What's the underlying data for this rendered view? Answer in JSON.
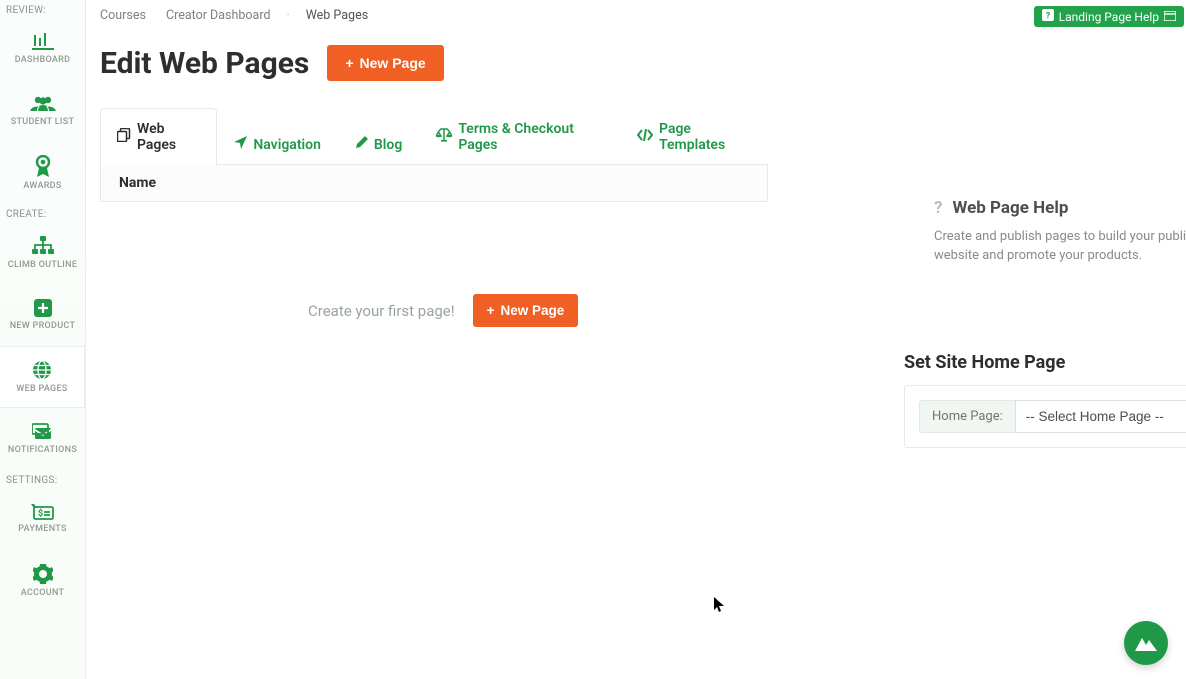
{
  "sidebar": {
    "sections": {
      "review": {
        "label": "REVIEW:"
      },
      "create": {
        "label": "CREATE:"
      },
      "settings": {
        "label": "SETTINGS:"
      }
    },
    "items": {
      "dashboard": "DASHBOARD",
      "student_list": "STUDENT LIST",
      "awards": "AWARDS",
      "climb_outline": "CLIMB OUTLINE",
      "new_product": "NEW PRODUCT",
      "web_pages": "WEB PAGES",
      "notifications": "NOTIFICATIONS",
      "payments": "PAYMENTS",
      "account": "ACCOUNT"
    }
  },
  "breadcrumbs": {
    "courses": "Courses",
    "dashboard": "Creator Dashboard",
    "current": "Web Pages"
  },
  "header": {
    "title": "Edit Web Pages",
    "new_page": "New Page",
    "help_badge": "Landing Page Help"
  },
  "tabs": {
    "web_pages": "Web Pages",
    "navigation": "Navigation",
    "blog": "Blog",
    "terms": "Terms & Checkout Pages",
    "templates": "Page Templates"
  },
  "table": {
    "col_name": "Name"
  },
  "empty": {
    "text": "Create your first page!",
    "button": "New Page"
  },
  "help_panel": {
    "title": "Web Page Help",
    "body": "Create and publish pages to build your public facing website and promote your products."
  },
  "home": {
    "section_title": "Set Site Home Page",
    "label": "Home Page:",
    "placeholder": "-- Select Home Page --"
  }
}
